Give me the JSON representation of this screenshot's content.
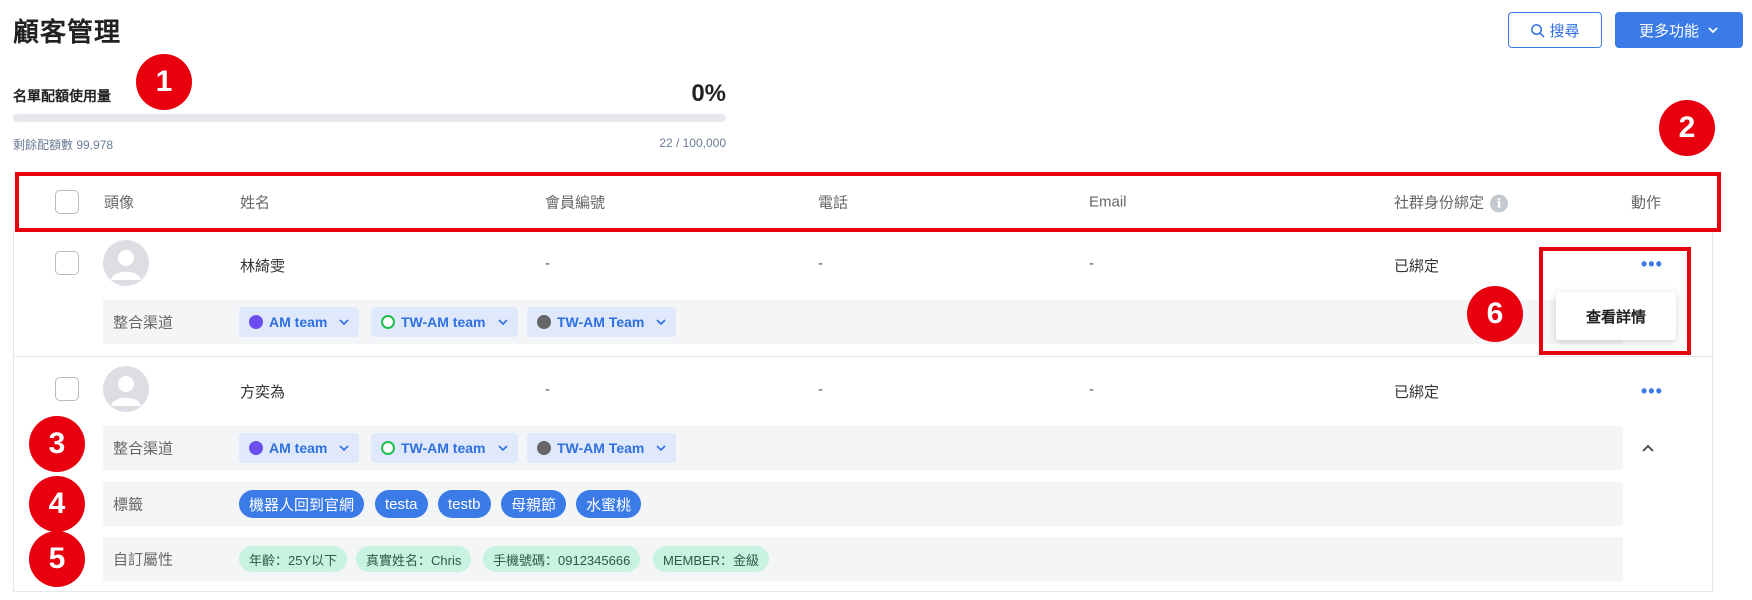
{
  "header": {
    "title": "顧客管理",
    "search_label": "搜尋",
    "more_label": "更多功能"
  },
  "quota": {
    "label": "名單配額使用量",
    "percent": "0%",
    "fill_fraction": 0.0,
    "remaining": "剩餘配額數 99,978",
    "used": "22 / 100,000"
  },
  "table": {
    "columns": [
      "頭像",
      "姓名",
      "會員編號",
      "電話",
      "Email",
      "社群身份綁定",
      "動作"
    ]
  },
  "rows": [
    {
      "name": "林綺雯",
      "member_id": "-",
      "phone": "-",
      "email": "-",
      "social_binding": "已綁定",
      "more": "•••",
      "channels_label": "整合渠道",
      "channels": [
        "AM team",
        "TW-AM team",
        "TW-AM Team"
      ]
    },
    {
      "name": "方奕為",
      "member_id": "-",
      "phone": "-",
      "email": "-",
      "social_binding": "已綁定",
      "more": "•••",
      "channels_label": "整合渠道",
      "channels": [
        "AM team",
        "TW-AM team",
        "TW-AM Team"
      ],
      "tags_label": "標籤",
      "tags": [
        "機器人回到官網",
        "testa",
        "testb",
        "母親節",
        "水蜜桃"
      ],
      "attrs_label": "自訂屬性",
      "attrs": [
        "年齡：25Y以下",
        "真實姓名：Chris",
        "手機號碼：0912345666",
        "MEMBER：金級"
      ]
    }
  ],
  "dropdown": {
    "view_details": "查看詳情"
  },
  "annotations": [
    "1",
    "2",
    "3",
    "4",
    "5",
    "6"
  ],
  "colors": {
    "accent": "#3b7be8",
    "annotation": "#e8000f",
    "attr_bg": "#c7f3e0"
  },
  "icons": [
    "search-icon",
    "chevron-down-icon",
    "info-icon",
    "avatar-icon",
    "messenger-icon",
    "line-icon",
    "webchat-icon",
    "chevron-up-icon"
  ]
}
